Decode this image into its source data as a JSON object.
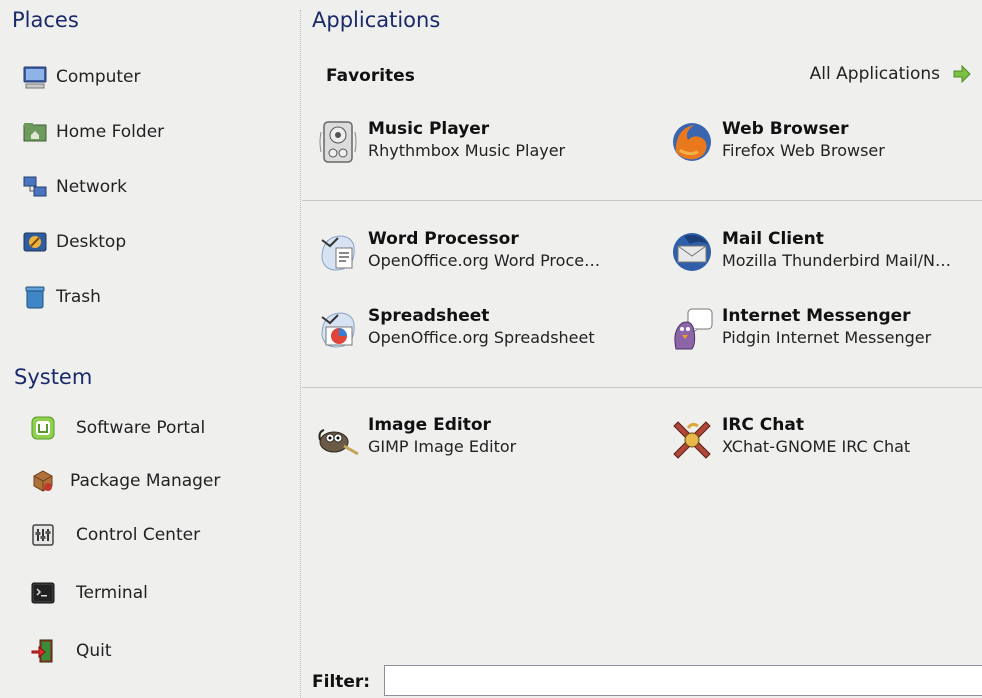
{
  "places": {
    "title": "Places",
    "items": [
      {
        "label": "Computer",
        "icon": "computer-icon"
      },
      {
        "label": "Home Folder",
        "icon": "home-folder-icon"
      },
      {
        "label": "Network",
        "icon": "network-icon"
      },
      {
        "label": "Desktop",
        "icon": "desktop-icon"
      },
      {
        "label": "Trash",
        "icon": "trash-icon"
      }
    ]
  },
  "system": {
    "title": "System",
    "items": [
      {
        "label": "Software Portal",
        "icon": "software-portal-icon"
      },
      {
        "label": "Package Manager",
        "icon": "package-manager-icon"
      },
      {
        "label": "Control Center",
        "icon": "control-center-icon"
      },
      {
        "label": "Terminal",
        "icon": "terminal-icon"
      },
      {
        "label": "Quit",
        "icon": "quit-icon"
      }
    ]
  },
  "applications": {
    "title": "Applications",
    "favorites_label": "Favorites",
    "all_applications_label": "All Applications",
    "apps": [
      {
        "name": "Music Player",
        "desc": "Rhythmbox Music Player",
        "icon": "music-player-icon"
      },
      {
        "name": "Web Browser",
        "desc": "Firefox Web Browser",
        "icon": "web-browser-icon"
      },
      {
        "name": "Word Processor",
        "desc": "OpenOffice.org Word Proce…",
        "icon": "word-processor-icon"
      },
      {
        "name": "Mail Client",
        "desc": "Mozilla Thunderbird Mail/N…",
        "icon": "mail-client-icon"
      },
      {
        "name": "Spreadsheet",
        "desc": "OpenOffice.org Spreadsheet",
        "icon": "spreadsheet-icon"
      },
      {
        "name": "Internet Messenger",
        "desc": "Pidgin Internet Messenger",
        "icon": "internet-messenger-icon"
      },
      {
        "name": "Image Editor",
        "desc": "GIMP Image Editor",
        "icon": "image-editor-icon"
      },
      {
        "name": "IRC Chat",
        "desc": "XChat-GNOME IRC Chat",
        "icon": "irc-chat-icon"
      }
    ]
  },
  "filter": {
    "label": "Filter:",
    "value": ""
  },
  "colors": {
    "background": "#eff0ee",
    "section_title": "#19296a",
    "arrow_green": "#7bc043"
  }
}
